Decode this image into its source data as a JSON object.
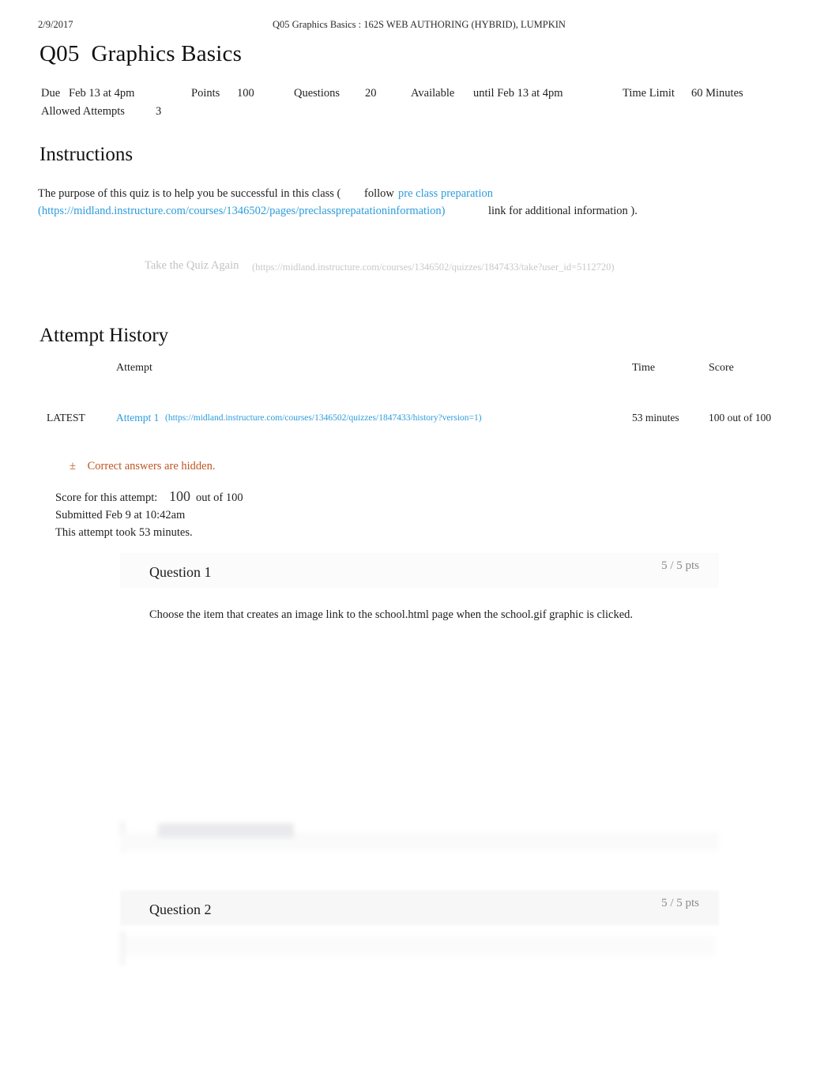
{
  "print_header": {
    "date": "2/9/2017",
    "title": "Q05  Graphics Basics : 162S WEB AUTHORING (HYBRID), LUMPKIN"
  },
  "page_title": "Q05  Graphics Basics",
  "quiz_meta": {
    "due_label": "Due",
    "due_value": "Feb 13 at 4pm",
    "points_label": "Points",
    "points_value": "100",
    "questions_label": "Questions",
    "questions_value": "20",
    "available_label": "Available",
    "available_value": "until Feb 13 at 4pm",
    "time_limit_label": "Time Limit",
    "time_limit_value": "60 Minutes",
    "allowed_attempts_label": "Allowed Attempts",
    "allowed_attempts_value": "3"
  },
  "instructions": {
    "heading": "Instructions",
    "text_before": "The purpose of this quiz is to help you be successful in this class (",
    "follow_word": "follow",
    "link_text": "pre class preparation",
    "link_url": "(https://midland.instructure.com/courses/1346502/pages/preclassprepatationinformation)",
    "text_after": "link for additional information  )."
  },
  "retake": {
    "label": "Take the Quiz Again",
    "url": "(https://midland.instructure.com/courses/1346502/quizzes/1847433/take?user_id=5112720)"
  },
  "attempt_history": {
    "heading": "Attempt History",
    "columns": {
      "attempt": "Attempt",
      "time": "Time",
      "score": "Score"
    },
    "rows": [
      {
        "latest_badge": "LATEST",
        "attempt_link": "Attempt 1",
        "attempt_url": "(https://midland.instructure.com/courses/1346502/quizzes/1847433/history?version=1)",
        "time": "53 minutes",
        "score": "100 out of 100"
      }
    ]
  },
  "hidden_notice": {
    "icon": "±",
    "text": "Correct answers are hidden."
  },
  "score_summary": {
    "score_label": "Score for this attempt:",
    "score_value": "100",
    "score_out_of": "out of 100",
    "submitted": "Submitted Feb 9 at 10:42am",
    "duration": "This attempt took 53 minutes."
  },
  "questions": [
    {
      "title": "Question 1",
      "points": "5 / 5 pts",
      "text": "Choose the item that creates an image link to the school.html page when the school.gif graphic is clicked."
    },
    {
      "title": "Question 2",
      "points": "5 / 5 pts",
      "text": ""
    }
  ],
  "colors": {
    "link": "#2d9cdb",
    "notice": "#bf5520",
    "muted": "#8a8a8a",
    "text": "#1f1f1f"
  }
}
